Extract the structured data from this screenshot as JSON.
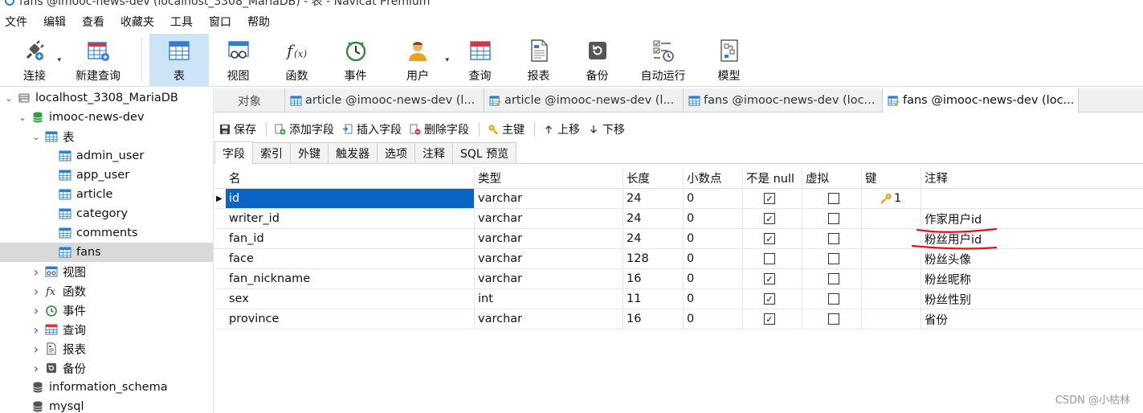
{
  "window": {
    "title": "fans @imooc-news-dev (localhost_3308_MariaDB) - 表 - Navicat Premium"
  },
  "menu": [
    "文件",
    "编辑",
    "查看",
    "收藏夹",
    "工具",
    "窗口",
    "帮助"
  ],
  "toolbar": [
    {
      "label": "连接",
      "icon": "plug-icon",
      "dropdown": true
    },
    {
      "label": "新建查询",
      "icon": "new-query-icon"
    },
    {
      "label": "表",
      "icon": "table-icon",
      "active": true
    },
    {
      "label": "视图",
      "icon": "view-icon"
    },
    {
      "label": "函数",
      "icon": "function-icon"
    },
    {
      "label": "事件",
      "icon": "clock-icon"
    },
    {
      "label": "用户",
      "icon": "user-icon",
      "dropdown": true
    },
    {
      "label": "查询",
      "icon": "query-icon"
    },
    {
      "label": "报表",
      "icon": "report-icon"
    },
    {
      "label": "备份",
      "icon": "backup-icon"
    },
    {
      "label": "自动运行",
      "icon": "autorun-icon"
    },
    {
      "label": "模型",
      "icon": "model-icon"
    }
  ],
  "navigator": {
    "items": [
      {
        "label": "localhost_3308_MariaDB",
        "level": 0,
        "icon": "server-icon",
        "expanded": true
      },
      {
        "label": "imooc-news-dev",
        "level": 1,
        "icon": "database-icon",
        "expanded": true
      },
      {
        "label": "表",
        "level": 2,
        "icon": "table-icon",
        "expanded": true
      },
      {
        "label": "admin_user",
        "level": 3,
        "icon": "table-icon"
      },
      {
        "label": "app_user",
        "level": 3,
        "icon": "table-icon"
      },
      {
        "label": "article",
        "level": 3,
        "icon": "table-icon"
      },
      {
        "label": "category",
        "level": 3,
        "icon": "table-icon"
      },
      {
        "label": "comments",
        "level": 3,
        "icon": "table-icon"
      },
      {
        "label": "fans",
        "level": 3,
        "icon": "table-icon",
        "selected": true
      },
      {
        "label": "视图",
        "level": 2,
        "icon": "view-icon",
        "expanded": false
      },
      {
        "label": "函数",
        "level": 2,
        "icon": "function-icon",
        "expanded": false
      },
      {
        "label": "事件",
        "level": 2,
        "icon": "clock-icon",
        "expanded": false
      },
      {
        "label": "查询",
        "level": 2,
        "icon": "query-icon",
        "expanded": false
      },
      {
        "label": "报表",
        "level": 2,
        "icon": "report-icon",
        "expanded": false
      },
      {
        "label": "备份",
        "level": 2,
        "icon": "backup-icon",
        "expanded": false
      },
      {
        "label": "information_schema",
        "level": 1,
        "icon": "database-gray-icon"
      },
      {
        "label": "mysql",
        "level": 1,
        "icon": "database-gray-icon"
      }
    ]
  },
  "tabs": {
    "objects": "对象",
    "docs": [
      {
        "label": "article @imooc-news-dev (l...",
        "icon": "table-icon"
      },
      {
        "label": "article @imooc-news-dev (l...",
        "icon": "design-table-icon"
      },
      {
        "label": "fans @imooc-news-dev (loc...",
        "icon": "table-icon"
      },
      {
        "label": "fans @imooc-news-dev (loc...",
        "icon": "design-table-icon",
        "active": true
      }
    ]
  },
  "objbar": {
    "save": "保存",
    "add_field": "添加字段",
    "insert_field": "插入字段",
    "delete_field": "删除字段",
    "primary_key": "主键",
    "move_up": "上移",
    "move_down": "下移"
  },
  "subtabs": [
    "字段",
    "索引",
    "外键",
    "触发器",
    "选项",
    "注释",
    "SQL 预览"
  ],
  "grid": {
    "headers": {
      "name": "名",
      "type": "类型",
      "length": "长度",
      "decimals": "小数点",
      "not_null": "不是 null",
      "virtual": "虚拟",
      "key": "键",
      "comment": "注释"
    },
    "rows": [
      {
        "name": "id",
        "type": "varchar",
        "length": "24",
        "decimals": "0",
        "not_null": true,
        "virtual": false,
        "key": "1",
        "comment": ""
      },
      {
        "name": "writer_id",
        "type": "varchar",
        "length": "24",
        "decimals": "0",
        "not_null": true,
        "virtual": false,
        "key": "",
        "comment": "作家用户id"
      },
      {
        "name": "fan_id",
        "type": "varchar",
        "length": "24",
        "decimals": "0",
        "not_null": true,
        "virtual": false,
        "key": "",
        "comment": "粉丝用户id"
      },
      {
        "name": "face",
        "type": "varchar",
        "length": "128",
        "decimals": "0",
        "not_null": false,
        "virtual": false,
        "key": "",
        "comment": "粉丝头像"
      },
      {
        "name": "fan_nickname",
        "type": "varchar",
        "length": "16",
        "decimals": "0",
        "not_null": true,
        "virtual": false,
        "key": "",
        "comment": "粉丝昵称"
      },
      {
        "name": "sex",
        "type": "int",
        "length": "11",
        "decimals": "0",
        "not_null": true,
        "virtual": false,
        "key": "",
        "comment": "粉丝性别"
      },
      {
        "name": "province",
        "type": "varchar",
        "length": "16",
        "decimals": "0",
        "not_null": true,
        "virtual": false,
        "key": "",
        "comment": "省份"
      }
    ]
  },
  "watermark": "CSDN @小枯林",
  "colors": {
    "accent": "#0a64c8",
    "active_tool": "#cde4f7",
    "annotation": "#e0121b"
  }
}
